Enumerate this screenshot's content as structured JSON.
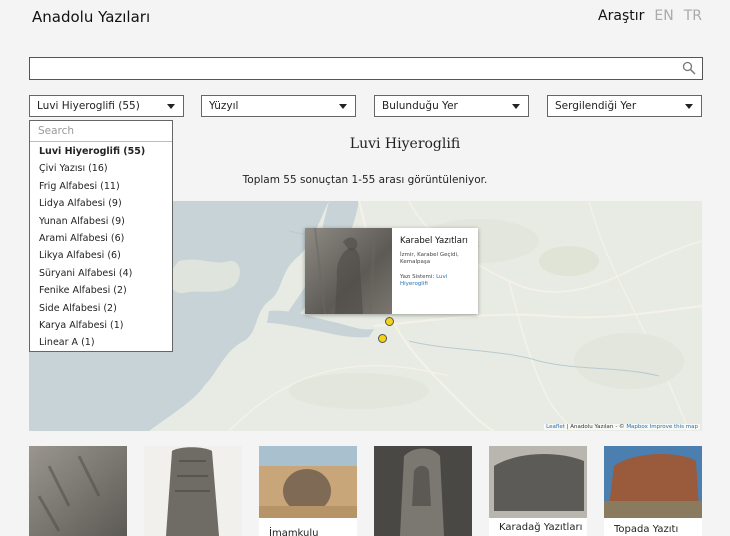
{
  "header": {
    "brand": "Anadolu Yazıları",
    "nav_search": "Araştır",
    "lang_en": "EN",
    "lang_tr": "TR"
  },
  "search": {
    "value": "",
    "placeholder": "",
    "icon": "search-icon"
  },
  "filters": [
    {
      "label": "Luvi Hiyeroglifi (55)"
    },
    {
      "label": "Yüzyıl"
    },
    {
      "label": "Bulunduğu Yer"
    },
    {
      "label": "Sergilendiği Yer"
    }
  ],
  "dropdown": {
    "search_placeholder": "Search",
    "items": [
      "Luvi Hiyeroglifi (55)",
      "Çivi Yazısı (16)",
      "Frig Alfabesi (11)",
      "Lidya Alfabesi (9)",
      "Yunan Alfabesi (9)",
      "Arami Alfabesi (6)",
      "Likya Alfabesi (6)",
      "Süryani Alfabesi (4)",
      "Fenike Alfabesi (2)",
      "Side Alfabesi (2)",
      "Karya Alfabesi (1)",
      "Linear A (1)"
    ]
  },
  "section_title": "Luvi Hiyeroglifi",
  "result_count": "Toplam 55 sonuçtan 1-55 arası görüntüleniyor.",
  "map": {
    "popup": {
      "title": "Karabel Yazıtları",
      "location": "İzmir, Karabel Geçidi, Kemalpaşa",
      "system_label": "Yazı Sistemi:",
      "system_value": "Luvi Hiyeroglifi"
    },
    "attribution_leaflet": "Leaflet",
    "attribution_mid": " | Anadolu Yazıları - © ",
    "attribution_mapbox": "Mapbox",
    "attribution_improve": "Improve this map",
    "marker_color": "#f3d21c"
  },
  "cards": [
    {
      "label": ""
    },
    {
      "label": ""
    },
    {
      "label": "İmamkulu"
    },
    {
      "label": ""
    },
    {
      "label": "Karadağ Yazıtları"
    },
    {
      "label": "Topada Yazıtı"
    }
  ]
}
